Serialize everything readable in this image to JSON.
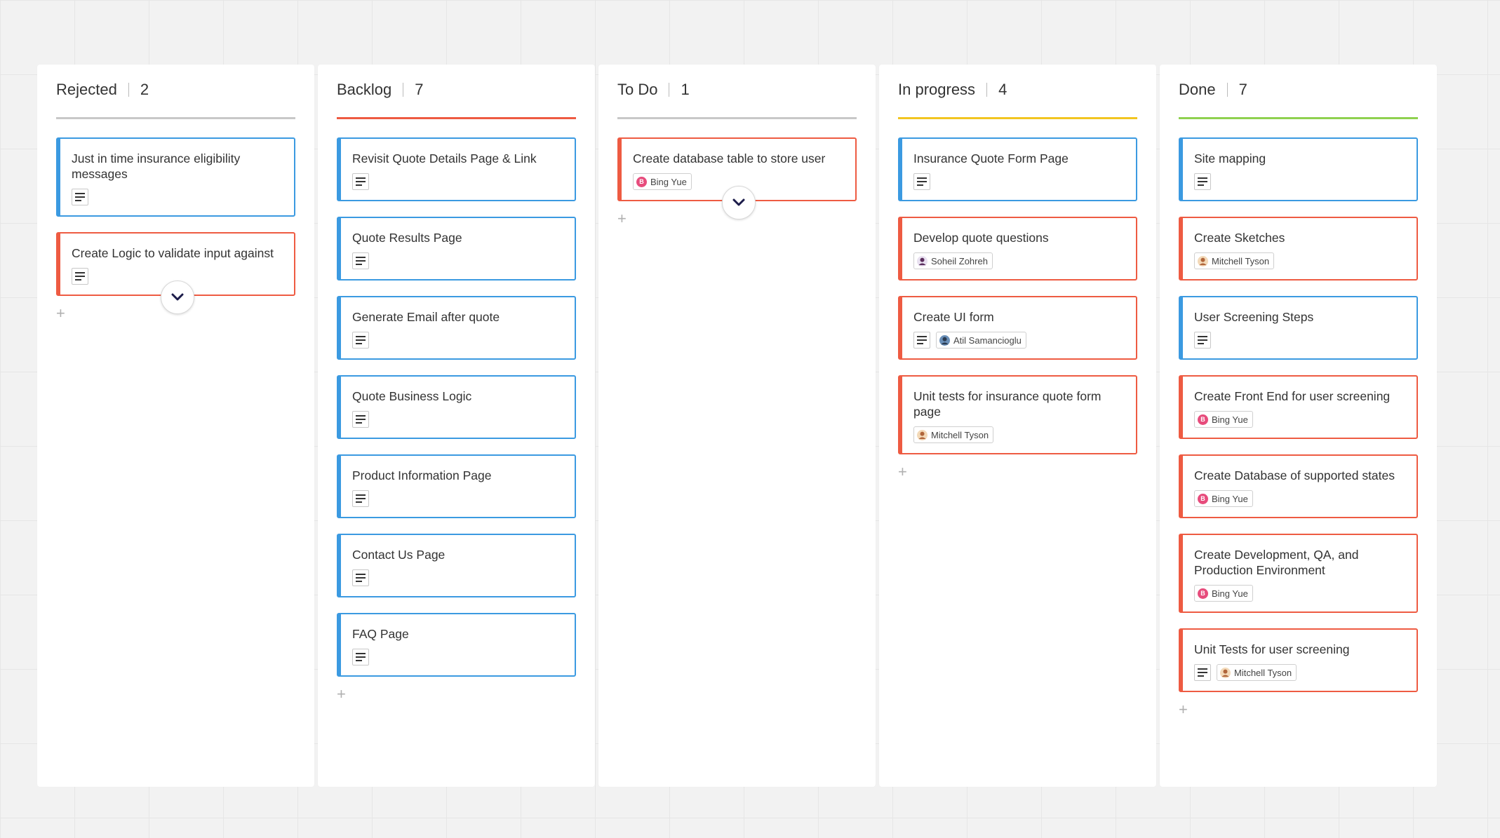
{
  "columns": [
    {
      "title": "Rejected",
      "count": "2",
      "color": "#c8c8c8",
      "cards": [
        {
          "title": "Just in time insurance eligibility messages",
          "color": "blue",
          "desc": true
        },
        {
          "title": "Create Logic to validate input against",
          "color": "red",
          "desc": true,
          "expand": true
        }
      ]
    },
    {
      "title": "Backlog",
      "count": "7",
      "color": "#ee5b42",
      "cards": [
        {
          "title": "Revisit Quote Details Page & Link",
          "color": "blue",
          "desc": true
        },
        {
          "title": "Quote Results Page",
          "color": "blue",
          "desc": true
        },
        {
          "title": "Generate Email after quote",
          "color": "blue",
          "desc": true
        },
        {
          "title": "Quote Business Logic",
          "color": "blue",
          "desc": true
        },
        {
          "title": "Product Information Page",
          "color": "blue",
          "desc": true
        },
        {
          "title": "Contact Us Page",
          "color": "blue",
          "desc": true
        },
        {
          "title": "FAQ Page",
          "color": "blue",
          "desc": true
        }
      ]
    },
    {
      "title": "To Do",
      "count": "1",
      "color": "#c8c8c8",
      "cards": [
        {
          "title": "Create database table to store user",
          "color": "red",
          "desc": false,
          "assignee": "Bing Yue",
          "avatar": "pink",
          "expand": true
        }
      ]
    },
    {
      "title": "In progress",
      "count": "4",
      "color": "#f2c521",
      "cards": [
        {
          "title": "Insurance Quote Form Page",
          "color": "blue",
          "desc": true
        },
        {
          "title": "Develop quote questions",
          "color": "red",
          "desc": false,
          "assignee": "Soheil Zohreh",
          "avatar": "person-dark"
        },
        {
          "title": "Create UI form",
          "color": "red",
          "desc": true,
          "assignee": "Atil Samancioglu",
          "avatar": "person-blue"
        },
        {
          "title": "Unit tests for insurance quote form page",
          "color": "red",
          "desc": false,
          "assignee": "Mitchell Tyson",
          "avatar": "person-tan"
        }
      ]
    },
    {
      "title": "Done",
      "count": "7",
      "color": "#8fd14f",
      "cards": [
        {
          "title": "Site mapping",
          "color": "blue",
          "desc": true
        },
        {
          "title": "Create Sketches",
          "color": "red",
          "desc": false,
          "assignee": "Mitchell Tyson",
          "avatar": "person-tan"
        },
        {
          "title": "User Screening Steps",
          "color": "blue",
          "desc": true
        },
        {
          "title": "Create Front End for user screening",
          "color": "red",
          "desc": false,
          "assignee": "Bing Yue",
          "avatar": "pink"
        },
        {
          "title": "Create Database of supported states",
          "color": "red",
          "desc": false,
          "assignee": "Bing Yue",
          "avatar": "pink"
        },
        {
          "title": "Create Development, QA, and Production Environment",
          "color": "red",
          "desc": false,
          "assignee": "Bing Yue",
          "avatar": "pink"
        },
        {
          "title": "Unit Tests for user screening",
          "color": "red",
          "desc": true,
          "assignee": "Mitchell Tyson",
          "avatar": "person-tan"
        }
      ]
    }
  ],
  "avatar_initial": "B",
  "add_label": "+"
}
